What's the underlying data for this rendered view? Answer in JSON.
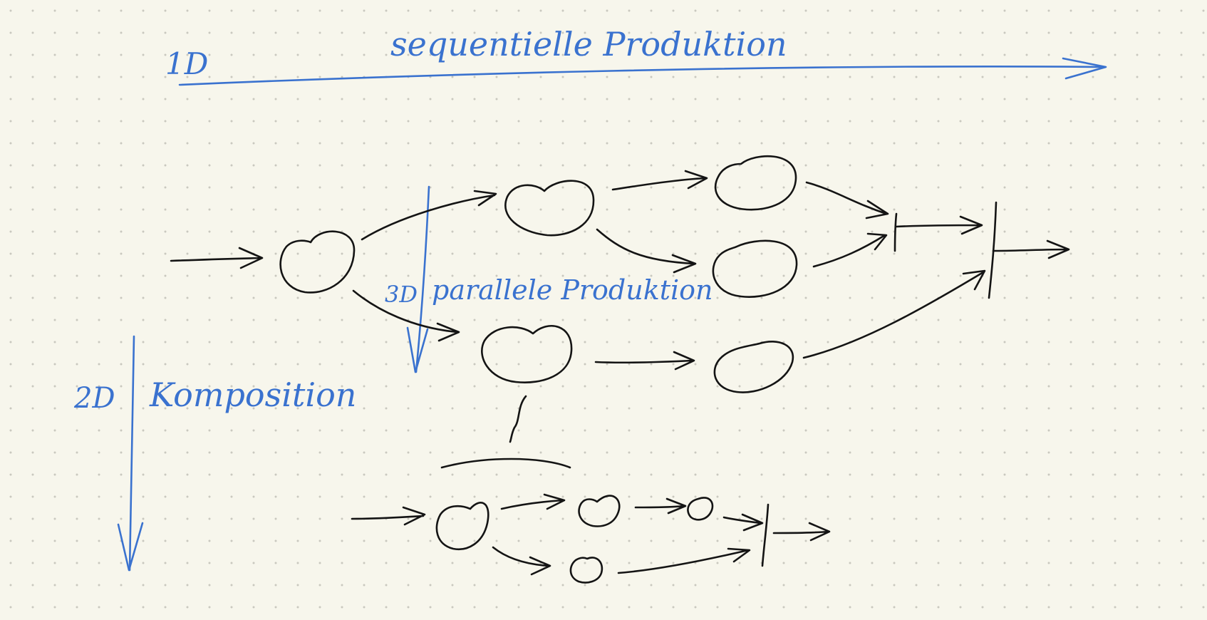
{
  "colors": {
    "background": "#f7f6ec",
    "dots": "#c9c8bf",
    "ink_black": "#141414",
    "ink_blue": "#3a72cf"
  },
  "labels": {
    "axis_1d_tag": "1D",
    "axis_1d_text": "sequentielle Produktion",
    "axis_2d_tag": "2D",
    "axis_2d_text": "Komposition",
    "axis_3d_tag": "3D",
    "axis_3d_text": "parallele Produktion"
  }
}
